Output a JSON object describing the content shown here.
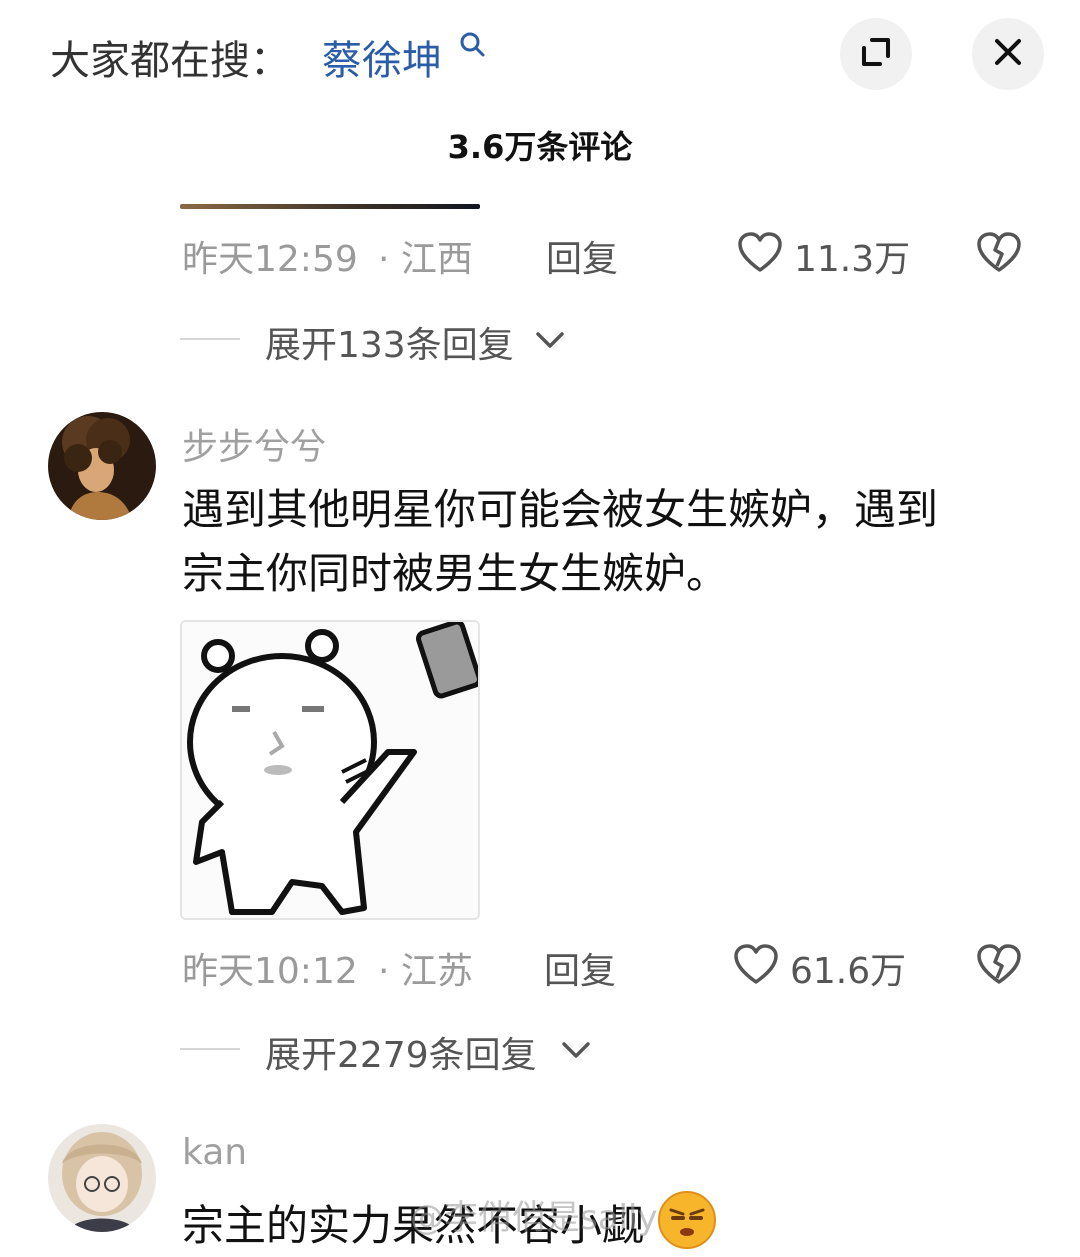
{
  "header": {
    "search_prefix": "大家都在搜：",
    "search_term": "蔡徐坤",
    "comment_count_title": "3.6万条评论"
  },
  "comments": [
    {
      "time": "昨天12:59",
      "location": "· 江西",
      "reply_label": "回复",
      "likes": "11.3万",
      "expand_label": "展开133条回复"
    },
    {
      "username": "步步兮兮",
      "text_line1": "遇到其他明星你可能会被女生嫉妒，遇到",
      "text_line2": "宗主你同时被男生女生嫉妒。",
      "time": "昨天10:12",
      "location": "· 江苏",
      "reply_label": "回复",
      "likes": "61.6万",
      "expand_label": "展开2279条回复"
    },
    {
      "username": "kan",
      "text": "宗主的实力果然不容小觑",
      "emoji": "smirk-face-emoji"
    }
  ],
  "watermark": "@李俏俏是sally",
  "colors": {
    "search_term": "#2a5ca8",
    "meta_gray": "#9a9a9a",
    "button_bg": "#f1f1f1"
  }
}
